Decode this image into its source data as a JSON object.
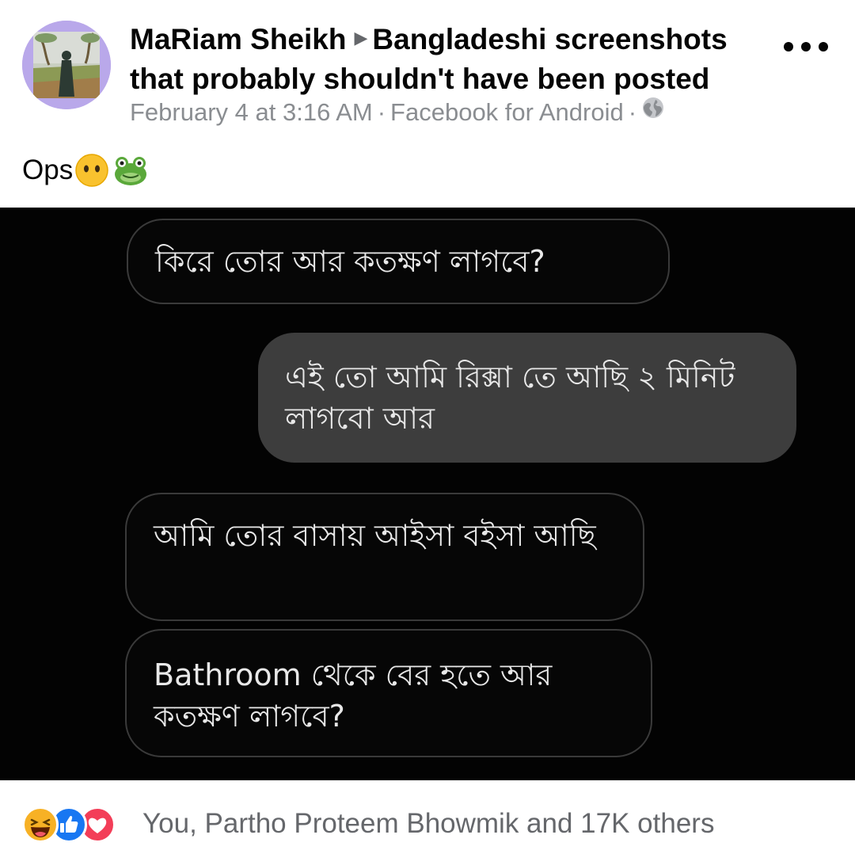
{
  "post": {
    "author": "MaRiam Sheikh",
    "group": "Bangladeshi screenshots that probably shouldn't have been posted",
    "time": "February 4 at 3:16 AM",
    "source": "Facebook for Android",
    "separator": "·",
    "caption": "Ops",
    "caption_emojis": [
      "face-without-mouth-icon",
      "frog-icon"
    ]
  },
  "chat": {
    "messages": [
      {
        "direction": "incoming",
        "text": "কিরে তোর আর কতক্ষণ লাগবে?"
      },
      {
        "direction": "outgoing",
        "text": "এই তো আমি রিক্সা তে আছি ২ মিনিট লাগবো আর"
      },
      {
        "direction": "incoming",
        "text": "আমি তোর বাসায় আইসা বইসা আছি"
      },
      {
        "direction": "incoming",
        "text": "Bathroom থেকে বের হতে আর কতক্ষণ লাগবে?"
      }
    ]
  },
  "reactions": {
    "icons": [
      "haha-icon",
      "like-icon",
      "love-icon"
    ],
    "summary": "You, Partho Proteem Bhowmik and 17K others"
  },
  "colors": {
    "text_primary": "#050505",
    "text_secondary": "#65676b",
    "like_blue": "#1877f2",
    "love_red": "#f33e58",
    "haha_yellow": "#f7b125",
    "photo_bg": "#030303",
    "outgoing_bubble": "#3d3d3d"
  }
}
